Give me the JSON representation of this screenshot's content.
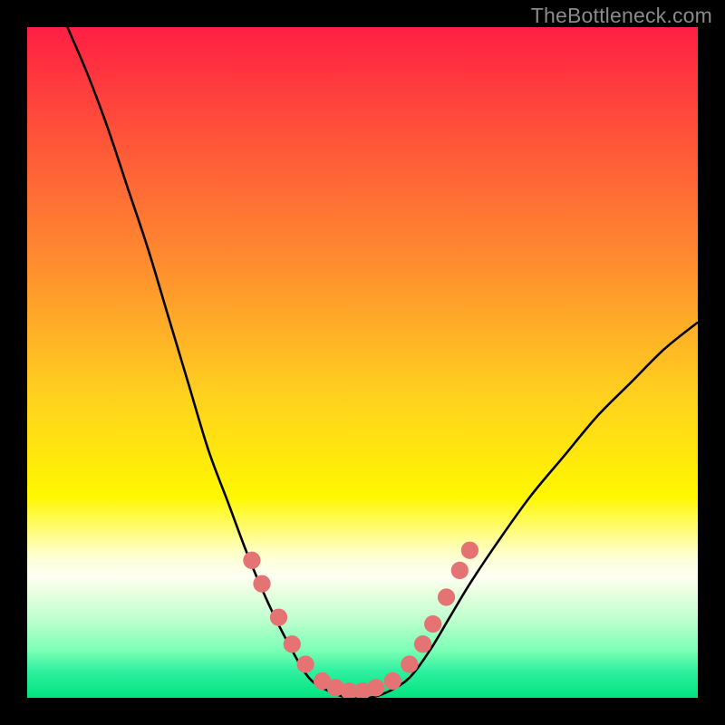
{
  "watermark": "TheBottleneck.com",
  "chart_data": {
    "type": "line",
    "title": "",
    "xlabel": "",
    "ylabel": "",
    "xlim": [
      0,
      100
    ],
    "ylim": [
      0,
      100
    ],
    "gradient_stops": [
      {
        "pos": 0,
        "color": "#ff1f44"
      },
      {
        "pos": 0.15,
        "color": "#ff4f3a"
      },
      {
        "pos": 0.35,
        "color": "#ff8c2f"
      },
      {
        "pos": 0.55,
        "color": "#ffd11f"
      },
      {
        "pos": 0.7,
        "color": "#fff700"
      },
      {
        "pos": 0.78,
        "color": "#ffffc0"
      },
      {
        "pos": 0.8,
        "color": "#fdffe0"
      },
      {
        "pos": 0.82,
        "color": "#fdfff2"
      },
      {
        "pos": 0.84,
        "color": "#ebffe0"
      },
      {
        "pos": 0.88,
        "color": "#c2ffd0"
      },
      {
        "pos": 0.93,
        "color": "#7affb5"
      },
      {
        "pos": 0.96,
        "color": "#30f0a0"
      },
      {
        "pos": 1.0,
        "color": "#00e47e"
      }
    ],
    "series": [
      {
        "name": "bottleneck-curve",
        "points": [
          {
            "x": 6,
            "y": 100
          },
          {
            "x": 9,
            "y": 93
          },
          {
            "x": 12,
            "y": 85
          },
          {
            "x": 15,
            "y": 76
          },
          {
            "x": 18,
            "y": 67
          },
          {
            "x": 21,
            "y": 57
          },
          {
            "x": 24,
            "y": 47
          },
          {
            "x": 27,
            "y": 37
          },
          {
            "x": 30,
            "y": 29
          },
          {
            "x": 33,
            "y": 21
          },
          {
            "x": 36,
            "y": 14
          },
          {
            "x": 39,
            "y": 8
          },
          {
            "x": 42,
            "y": 3
          },
          {
            "x": 45,
            "y": 1
          },
          {
            "x": 48,
            "y": 0
          },
          {
            "x": 51,
            "y": 0
          },
          {
            "x": 54,
            "y": 1
          },
          {
            "x": 57,
            "y": 3
          },
          {
            "x": 60,
            "y": 7
          },
          {
            "x": 63,
            "y": 12
          },
          {
            "x": 66,
            "y": 17
          },
          {
            "x": 70,
            "y": 23
          },
          {
            "x": 75,
            "y": 30
          },
          {
            "x": 80,
            "y": 36
          },
          {
            "x": 85,
            "y": 42
          },
          {
            "x": 90,
            "y": 47
          },
          {
            "x": 95,
            "y": 52
          },
          {
            "x": 100,
            "y": 56
          }
        ]
      }
    ],
    "markers": [
      {
        "x": 33.5,
        "y": 20.5
      },
      {
        "x": 35,
        "y": 17
      },
      {
        "x": 37.5,
        "y": 12
      },
      {
        "x": 39.5,
        "y": 8
      },
      {
        "x": 41.5,
        "y": 5
      },
      {
        "x": 44,
        "y": 2.5
      },
      {
        "x": 46,
        "y": 1.5
      },
      {
        "x": 48,
        "y": 1
      },
      {
        "x": 50,
        "y": 1
      },
      {
        "x": 52,
        "y": 1.5
      },
      {
        "x": 54.5,
        "y": 2.5
      },
      {
        "x": 57,
        "y": 5
      },
      {
        "x": 59,
        "y": 8
      },
      {
        "x": 60.5,
        "y": 11
      },
      {
        "x": 62.5,
        "y": 15
      },
      {
        "x": 64.5,
        "y": 19
      },
      {
        "x": 66,
        "y": 22
      }
    ],
    "marker_color": "#e57373",
    "marker_radius": 1.3
  }
}
